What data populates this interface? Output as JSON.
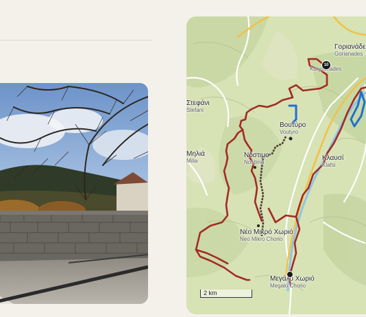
{
  "map": {
    "villages": [
      {
        "greek": "Γοριανάδες",
        "latin": "Gorianades"
      },
      {
        "greek": "",
        "latin": "Koryschades"
      },
      {
        "greek": "Στεφάνι",
        "latin": "Stefani"
      },
      {
        "greek": "Βουτύρο",
        "latin": "Voutyro"
      },
      {
        "greek": "Νόστιμο",
        "latin": "Nostimo"
      },
      {
        "greek": "Μηλιά",
        "latin": "Milia"
      },
      {
        "greek": "Κλαυσί",
        "latin": "Klafsi"
      },
      {
        "greek": "Νέο Μικρό Χωριό",
        "latin": "Neo Mikro Chorio"
      },
      {
        "greek": "Μεγάλο Χωριό",
        "latin": "Megalo Chorio"
      }
    ],
    "waypoint_label": "10",
    "scale_label": "2 km",
    "colors": {
      "route": "#a12b22",
      "route_alt": "#4a3a33",
      "water": "#1e6fd1",
      "road": "#f2c14e",
      "terrain": "#d5e0b4"
    }
  },
  "photo": {
    "subject": "stone wall under bare tree branches"
  }
}
